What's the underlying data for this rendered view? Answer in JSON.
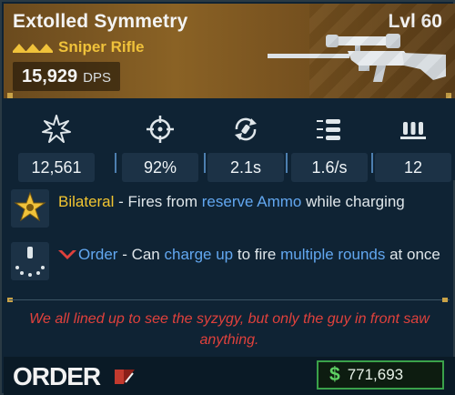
{
  "item": {
    "name": "Extolled Symmetry",
    "level": "Lvl 60",
    "weapon_type": "Sniper Rifle",
    "dps_value": "15,929",
    "dps_label": "DPS",
    "rarity_color": "#f0c23a"
  },
  "stats": [
    {
      "icon": "damage-burst-icon",
      "value": "12,561"
    },
    {
      "icon": "crosshair-accuracy-icon",
      "value": "92%"
    },
    {
      "icon": "reload-icon",
      "value": "2.1s"
    },
    {
      "icon": "fire-rate-icon",
      "value": "1.6/s"
    },
    {
      "icon": "magazine-ammo-icon",
      "value": "12"
    }
  ],
  "perks": [
    {
      "icon": "star-badge-icon",
      "name": "Bilateral",
      "sep": " - Fires from ",
      "hl": "reserve Ammo",
      "rest": " while charging"
    },
    {
      "icon": "charge-rounds-icon",
      "manufacturer_icon": "chevron-down-icon",
      "name": "Order",
      "sep": " - Can ",
      "hl1": "charge up",
      "mid": " to fire ",
      "hl2": "multiple rounds",
      "rest": " at once"
    }
  ],
  "flavor_text": "We all lined up to see the syzygy, but only the guy in front saw anything.",
  "footer": {
    "manufacturer_logo": "ORDER",
    "currency_icon": "$",
    "price": "771,693"
  },
  "colors": {
    "accent_gold": "#f0c23a",
    "highlight_blue": "#62a7f0",
    "flavor_red": "#e0413c",
    "money_green": "#3aa14a"
  }
}
